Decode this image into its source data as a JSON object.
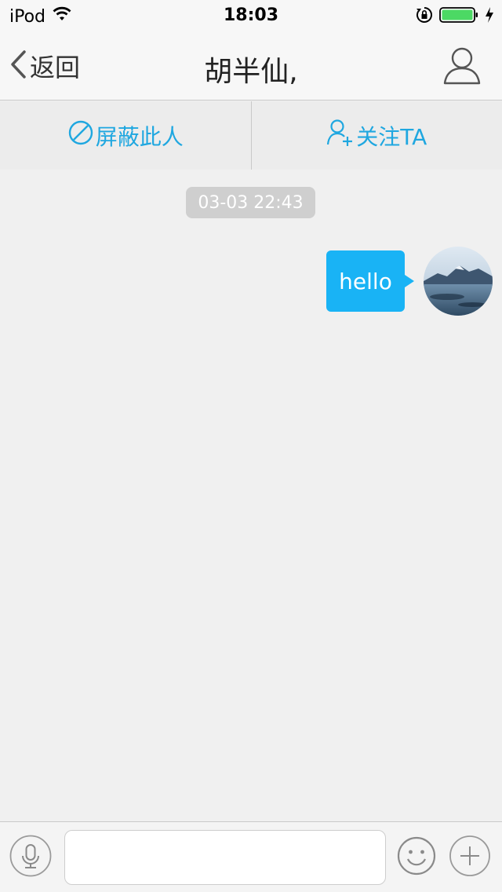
{
  "status_bar": {
    "carrier": "iPod",
    "time": "18:03",
    "icons": [
      "wifi-icon",
      "rotation-lock-icon",
      "battery-icon",
      "charging-icon"
    ],
    "battery_color": "#4cd964"
  },
  "nav": {
    "back_label": "返回",
    "title": "胡半仙,",
    "icons": [
      "chevron-left-icon",
      "person-icon"
    ]
  },
  "actions": {
    "block_label": "屏蔽此人",
    "follow_label": "关注TA",
    "icons": [
      "block-icon",
      "add-person-icon"
    ],
    "accent_color": "#1fa7e0"
  },
  "chat": {
    "timestamp": "03-03 22:43",
    "messages": [
      {
        "text": "hello",
        "sender": "self"
      }
    ],
    "bubble_color": "#19b3f5"
  },
  "input_bar": {
    "message_value": "",
    "icons": [
      "microphone-icon",
      "smiley-icon",
      "plus-icon"
    ]
  }
}
